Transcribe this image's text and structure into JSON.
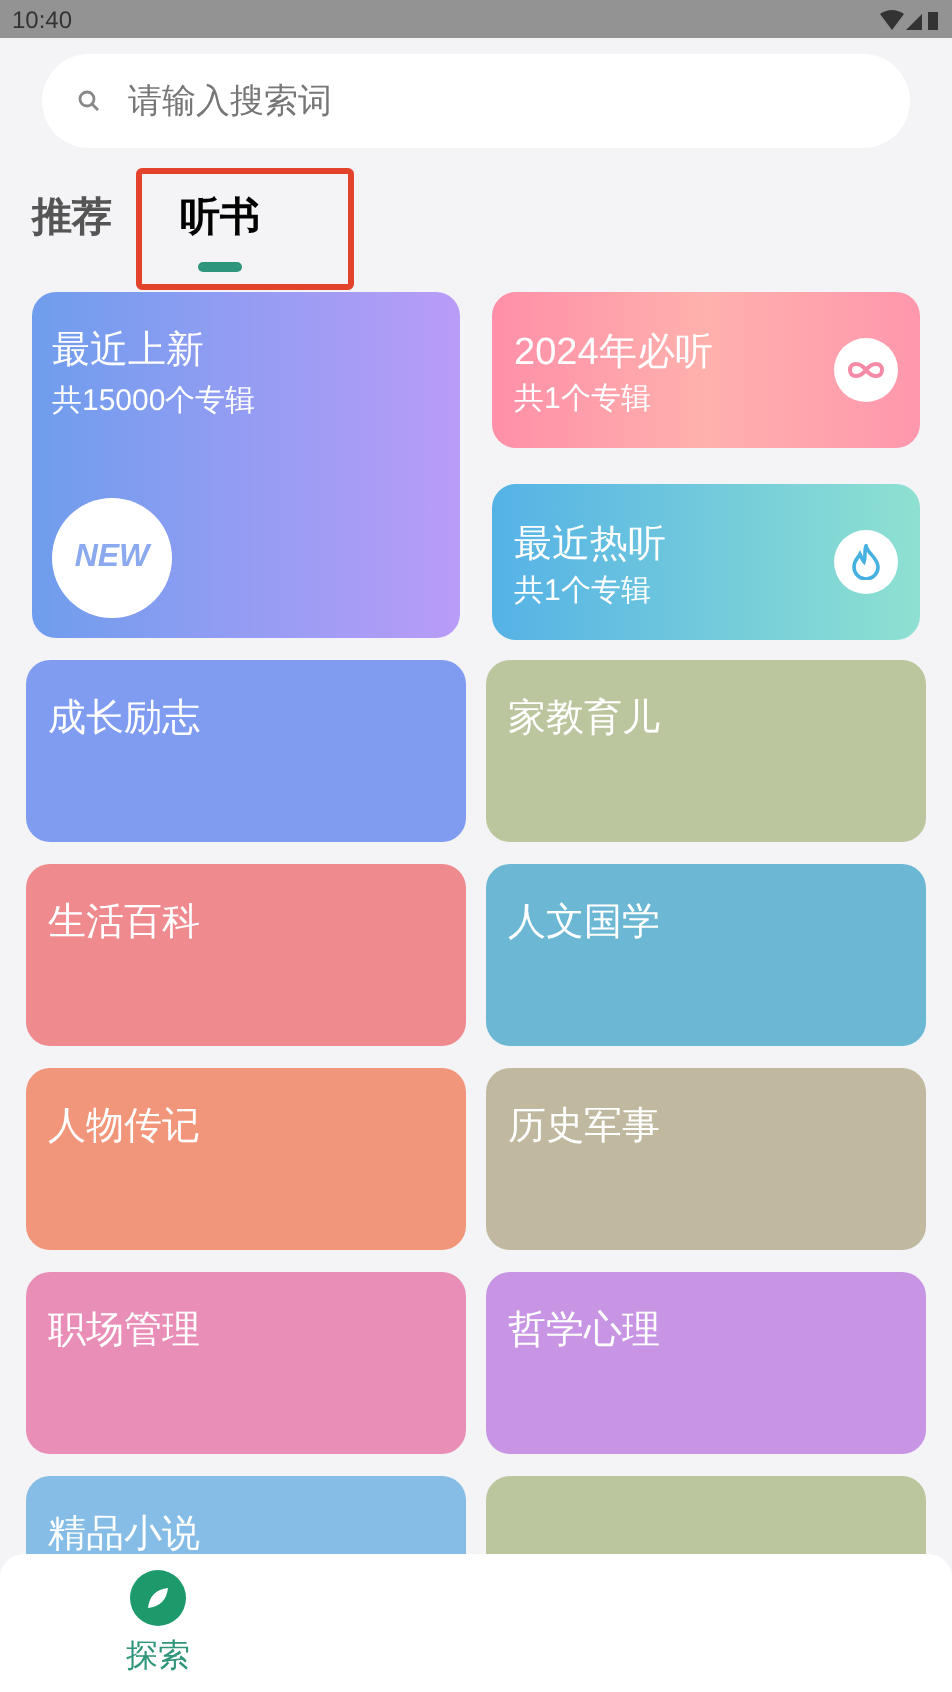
{
  "status_bar": {
    "time": "10:40"
  },
  "search": {
    "placeholder": "请输入搜索词"
  },
  "tabs": [
    {
      "label": "推荐",
      "selected": false
    },
    {
      "label": "听书",
      "selected": true
    }
  ],
  "featured": [
    {
      "kind": "new",
      "title": "最近上新",
      "subtitle": "共15000个专辑",
      "badge": "NEW"
    },
    {
      "kind": "infinity",
      "title": "2024年必听",
      "subtitle": "共1个专辑"
    },
    {
      "kind": "flame",
      "title": "最近热听",
      "subtitle": "共1个专辑"
    }
  ],
  "categories": [
    {
      "label": "成长励志",
      "color": "#7f9cf1"
    },
    {
      "label": "家教育儿",
      "color": "#bcc69e"
    },
    {
      "label": "生活百科",
      "color": "#ef8a8f"
    },
    {
      "label": "人文国学",
      "color": "#6cb8d4"
    },
    {
      "label": "人物传记",
      "color": "#f2967b"
    },
    {
      "label": "历史军事",
      "color": "#c0b89f"
    },
    {
      "label": "职场管理",
      "color": "#e98fb7"
    },
    {
      "label": "哲学心理",
      "color": "#c795e4"
    },
    {
      "label": "精品小说",
      "color": "#86bde6"
    },
    {
      "color": "#bcc69e"
    }
  ],
  "bottom_nav": [
    {
      "label": "探索",
      "selected": true
    }
  ]
}
